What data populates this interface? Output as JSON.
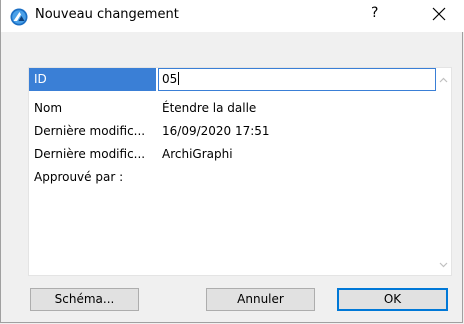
{
  "window": {
    "title": "Nouveau changement",
    "help_label": "?",
    "app_icon": "archicad-logo-icon",
    "close_icon": "close-icon"
  },
  "properties": {
    "rows": [
      {
        "key": "ID",
        "value": "05",
        "selected": true,
        "editing": true
      },
      {
        "key": "Nom",
        "value": "Étendre la dalle"
      },
      {
        "key": "Dernière modific...",
        "value": "16/09/2020 17:51"
      },
      {
        "key": "Dernière modific...",
        "value": "ArchiGraphi"
      },
      {
        "key": "Approuvé par :",
        "value": ""
      }
    ]
  },
  "scrollbar": {
    "up_icon": "chevron-up-icon",
    "down_icon": "chevron-down-icon"
  },
  "buttons": {
    "schema_label": "Schéma...",
    "cancel_label": "Annuler",
    "ok_label": "OK"
  },
  "colors": {
    "selection": "#3a7fd6",
    "accent": "#0078d7"
  }
}
